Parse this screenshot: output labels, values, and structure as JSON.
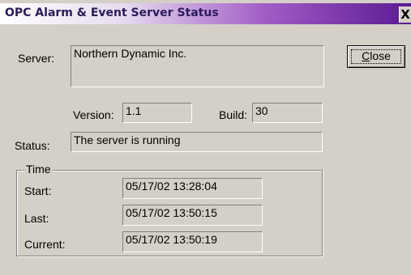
{
  "window": {
    "title": "OPC Alarm & Event Server Status",
    "close_glyph": "X"
  },
  "server": {
    "label": "Server:",
    "value": "Northern Dynamic Inc."
  },
  "version": {
    "label": "Version:",
    "value": "1.1"
  },
  "build": {
    "label": "Build:",
    "value": "30"
  },
  "status": {
    "label": "Status:",
    "value": "The server is running"
  },
  "time": {
    "group_label": "Time",
    "start_label": "Start:",
    "start_value": "05/17/02 13:28:04",
    "last_label": "Last:",
    "last_value": "05/17/02 13:50:15",
    "current_label": "Current:",
    "current_value": "05/17/02 13:50:19"
  },
  "buttons": {
    "close_prefix": "C",
    "close_rest": "lose"
  }
}
